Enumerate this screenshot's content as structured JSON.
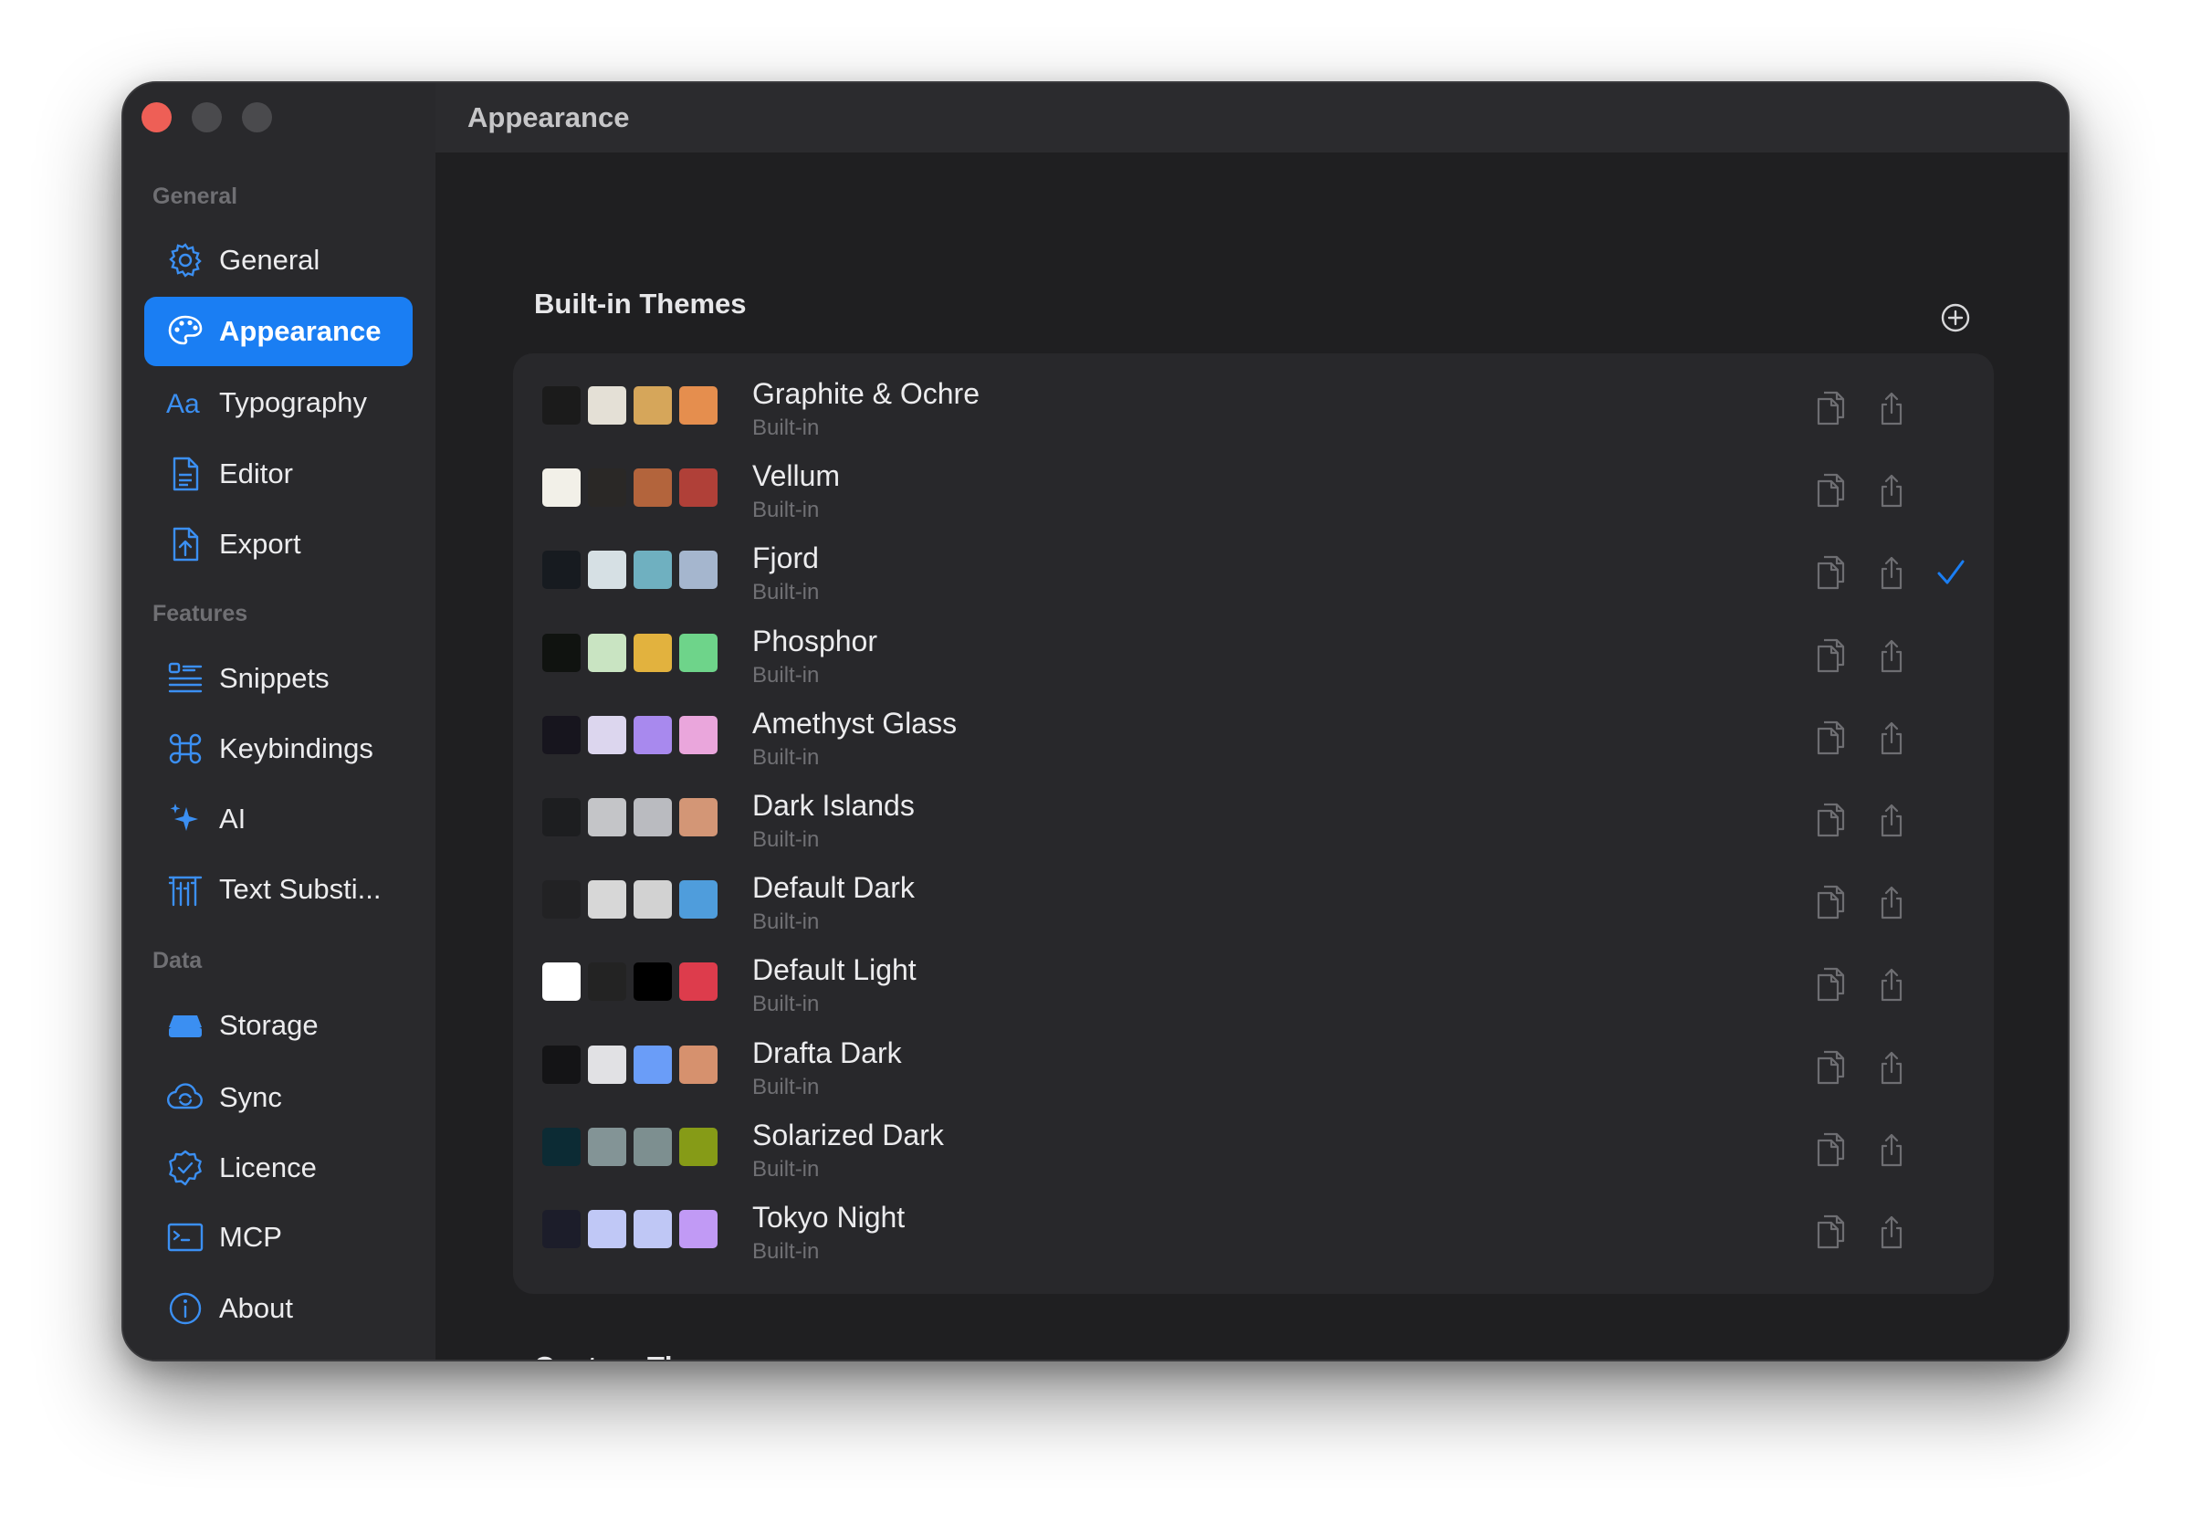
{
  "window": {
    "title": "Appearance"
  },
  "sidebar": {
    "sections": [
      {
        "label": "General",
        "items": [
          {
            "label": "General",
            "icon": "gear-icon"
          },
          {
            "label": "Appearance",
            "icon": "palette-icon",
            "active": true
          },
          {
            "label": "Typography",
            "icon": "typography-icon"
          },
          {
            "label": "Editor",
            "icon": "document-icon"
          },
          {
            "label": "Export",
            "icon": "export-icon"
          }
        ]
      },
      {
        "label": "Features",
        "items": [
          {
            "label": "Snippets",
            "icon": "snippets-icon"
          },
          {
            "label": "Keybindings",
            "icon": "command-icon"
          },
          {
            "label": "AI",
            "icon": "sparkles-icon"
          },
          {
            "label": "Text Substi...",
            "icon": "text-substitution-icon"
          }
        ]
      },
      {
        "label": "Data",
        "items": [
          {
            "label": "Storage",
            "icon": "storage-icon"
          },
          {
            "label": "Sync",
            "icon": "sync-icon"
          },
          {
            "label": "Licence",
            "icon": "licence-badge-icon"
          },
          {
            "label": "MCP",
            "icon": "terminal-icon"
          },
          {
            "label": "About",
            "icon": "info-icon"
          }
        ]
      }
    ]
  },
  "main": {
    "builtin_title": "Built-in Themes",
    "custom_title": "Custom Themes",
    "themes": [
      {
        "name": "Graphite & Ochre",
        "sub": "Built-in",
        "swatches": [
          "#1b1b1b",
          "#e4e0d6",
          "#d6a65a",
          "#e58e4e"
        ],
        "selected": false
      },
      {
        "name": "Vellum",
        "sub": "Built-in",
        "swatches": [
          "#f2f0e8",
          "#2a2826",
          "#b3643c",
          "#b04038"
        ],
        "selected": false
      },
      {
        "name": "Fjord",
        "sub": "Built-in",
        "swatches": [
          "#171b20",
          "#d6e0e4",
          "#6fb0c0",
          "#a5b6ce"
        ],
        "selected": true
      },
      {
        "name": "Phosphor",
        "sub": "Built-in",
        "swatches": [
          "#101310",
          "#c9e4c2",
          "#e2b23e",
          "#6ed48a"
        ],
        "selected": false
      },
      {
        "name": "Amethyst Glass",
        "sub": "Built-in",
        "swatches": [
          "#17151e",
          "#dcd6ee",
          "#a889ee",
          "#eaa6dc"
        ],
        "selected": false
      },
      {
        "name": "Dark Islands",
        "sub": "Built-in",
        "swatches": [
          "#1d1e20",
          "#c4c5c8",
          "#babbc0",
          "#d39676"
        ],
        "selected": false
      },
      {
        "name": "Default Dark",
        "sub": "Built-in",
        "swatches": [
          "#222224",
          "#d7d7d7",
          "#d2d2d2",
          "#4f9ddc"
        ],
        "selected": false
      },
      {
        "name": "Default Light",
        "sub": "Built-in",
        "swatches": [
          "#ffffff",
          "#232323",
          "#000000",
          "#dd3c4c"
        ],
        "selected": false
      },
      {
        "name": "Drafta Dark",
        "sub": "Built-in",
        "swatches": [
          "#141416",
          "#e1e1e4",
          "#6a9df8",
          "#d6916e"
        ],
        "selected": false
      },
      {
        "name": "Solarized Dark",
        "sub": "Built-in",
        "swatches": [
          "#0c2b34",
          "#839496",
          "#7d8f90",
          "#869b17"
        ],
        "selected": false
      },
      {
        "name": "Tokyo Night",
        "sub": "Built-in",
        "swatches": [
          "#1c1d2a",
          "#c0c8f6",
          "#bfc7f5",
          "#c19af5"
        ],
        "selected": false
      }
    ]
  },
  "colors": {
    "accent": "#1a7ef3",
    "close": "#ee5f56"
  }
}
